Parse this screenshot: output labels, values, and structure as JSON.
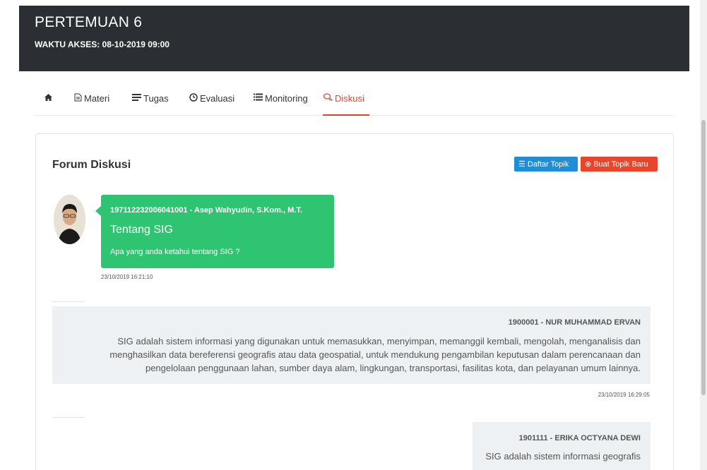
{
  "header": {
    "title": "PERTEMUAN 6",
    "access": "WAKTU AKSES: 08-10-2019 09:00"
  },
  "tabs": [
    {
      "label": "",
      "icon": "home-icon"
    },
    {
      "label": "Materi",
      "icon": "document-icon"
    },
    {
      "label": "Tugas",
      "icon": "tasks-icon"
    },
    {
      "label": "Evaluasi",
      "icon": "clock-icon"
    },
    {
      "label": "Monitoring",
      "icon": "list-icon"
    },
    {
      "label": "Diskusi",
      "icon": "chat-icon",
      "active": true
    }
  ],
  "forum": {
    "title": "Forum Diskusi",
    "btn_topics": "Daftar Topik",
    "btn_new_topic": "Buat Topik Baru"
  },
  "post": {
    "author": "197112232006041001 - Asep Wahyudin, S.Kom., M.T.",
    "topic": "Tentang SIG",
    "question": "Apa yang anda ketahui tentang SIG ?",
    "time": "23/10/2019 16:21:10"
  },
  "replies": [
    {
      "author": "1900001 - NUR MUHAMMAD ERVAN",
      "text": "SIG adalah sistem informasi yang digunakan untuk memasukkan, menyimpan, memanggil kembali, mengolah, menganalisis dan menghasilkan data bereferensi geografis atau data geospatial, untuk mendukung pengambilan keputusan dalam perencanaan dan pengelolaan penggunaan lahan, sumber daya alam, lingkungan, transportasi, fasilitas kota, dan pelayanan umum lainnya.",
      "time": "23/10/2019 16:29:05"
    },
    {
      "author": "1901111 - ERIKA OCTYANA DEWI",
      "text": "SIG adalah sistem informasi geografis"
    }
  ],
  "colors": {
    "header_bg": "#2b2f33",
    "accent": "#e2452b",
    "bubble": "#2fc471",
    "btn_blue": "#1f8ed6",
    "btn_red": "#e8452b"
  }
}
